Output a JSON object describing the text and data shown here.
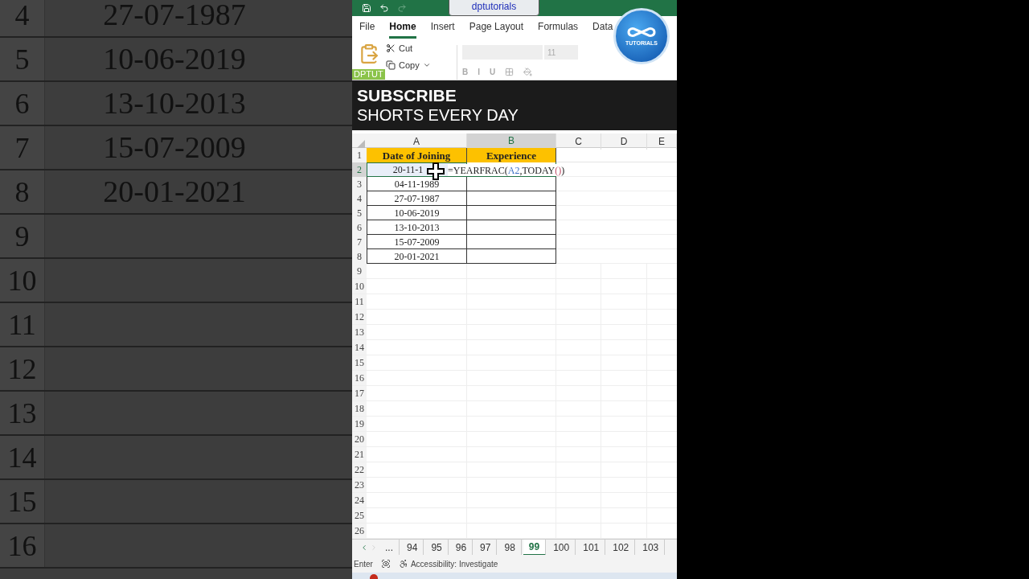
{
  "background_zoom": {
    "rows": [
      {
        "number": "4",
        "date": "27-07-1987"
      },
      {
        "number": "5",
        "date": "10-06-2019"
      },
      {
        "number": "6",
        "date": "13-10-2013"
      },
      {
        "number": "7",
        "date": "15-07-2009"
      },
      {
        "number": "8",
        "date": "20-01-2021"
      },
      {
        "number": "9"
      },
      {
        "number": "10"
      },
      {
        "number": "11"
      },
      {
        "number": "12"
      },
      {
        "number": "13"
      },
      {
        "number": "14"
      },
      {
        "number": "15"
      },
      {
        "number": "16"
      }
    ]
  },
  "title_bar": {
    "title": "dptutorials"
  },
  "menu_tabs": [
    {
      "label": "File",
      "selected": false
    },
    {
      "label": "Home",
      "selected": true
    },
    {
      "label": "Insert",
      "selected": false
    },
    {
      "label": "Page Layout",
      "selected": false
    },
    {
      "label": "Formulas",
      "selected": false
    },
    {
      "label": "Data",
      "selected": false
    }
  ],
  "ribbon": {
    "cut": "Cut",
    "copy": "Copy",
    "font_size": "11",
    "format_buttons": [
      "B",
      "I",
      "U"
    ],
    "badge": "DPTUT"
  },
  "logo": {
    "text": "TUTORIALS"
  },
  "banner": {
    "title": "SUBSCRIBE",
    "subtitle": "SHORTS EVERY DAY"
  },
  "sheet": {
    "columns": [
      {
        "label": "A",
        "selected": false
      },
      {
        "label": "B",
        "selected": true
      },
      {
        "label": "C",
        "selected": false
      },
      {
        "label": "D",
        "selected": false
      },
      {
        "label": "E",
        "selected": false
      }
    ],
    "header": {
      "number": "1",
      "cells": [
        "Date of Joining",
        "Experience"
      ]
    },
    "rows": [
      {
        "number": "2",
        "date": "20-11-1",
        "selected": true
      },
      {
        "number": "3",
        "date": "04-11-1989",
        "selected": false
      },
      {
        "number": "4",
        "date": "27-07-1987",
        "selected": false
      },
      {
        "number": "5",
        "date": "10-06-2019",
        "selected": false
      },
      {
        "number": "6",
        "date": "13-10-2013",
        "selected": false
      },
      {
        "number": "7",
        "date": "15-07-2009",
        "selected": false
      },
      {
        "number": "8",
        "date": "20-01-2021",
        "selected": false
      }
    ],
    "empty_rows": [
      "9",
      "10",
      "11",
      "12",
      "13",
      "14",
      "15",
      "16",
      "17",
      "18",
      "19",
      "20",
      "21",
      "22",
      "23",
      "24",
      "25",
      "26"
    ],
    "formula_parts": [
      {
        "text": "=YEARFRAC(",
        "kind": "plain"
      },
      {
        "text": "A2",
        "kind": "ref"
      },
      {
        "text": ",TODAY",
        "kind": "plain"
      },
      {
        "text": "()",
        "kind": "paren"
      },
      {
        "text": ")",
        "kind": "plain"
      }
    ]
  },
  "sheet_tabs": [
    {
      "label": "...",
      "selected": false
    },
    {
      "label": "94",
      "selected": false
    },
    {
      "label": "95",
      "selected": false
    },
    {
      "label": "96",
      "selected": false
    },
    {
      "label": "97",
      "selected": false
    },
    {
      "label": "98",
      "selected": false
    },
    {
      "label": "99",
      "selected": true
    },
    {
      "label": "100",
      "selected": false
    },
    {
      "label": "101",
      "selected": false
    },
    {
      "label": "102",
      "selected": false
    },
    {
      "label": "103",
      "selected": false
    }
  ],
  "status_bar": {
    "mode": "Enter",
    "accessibility": "Accessibility: Investigate"
  }
}
